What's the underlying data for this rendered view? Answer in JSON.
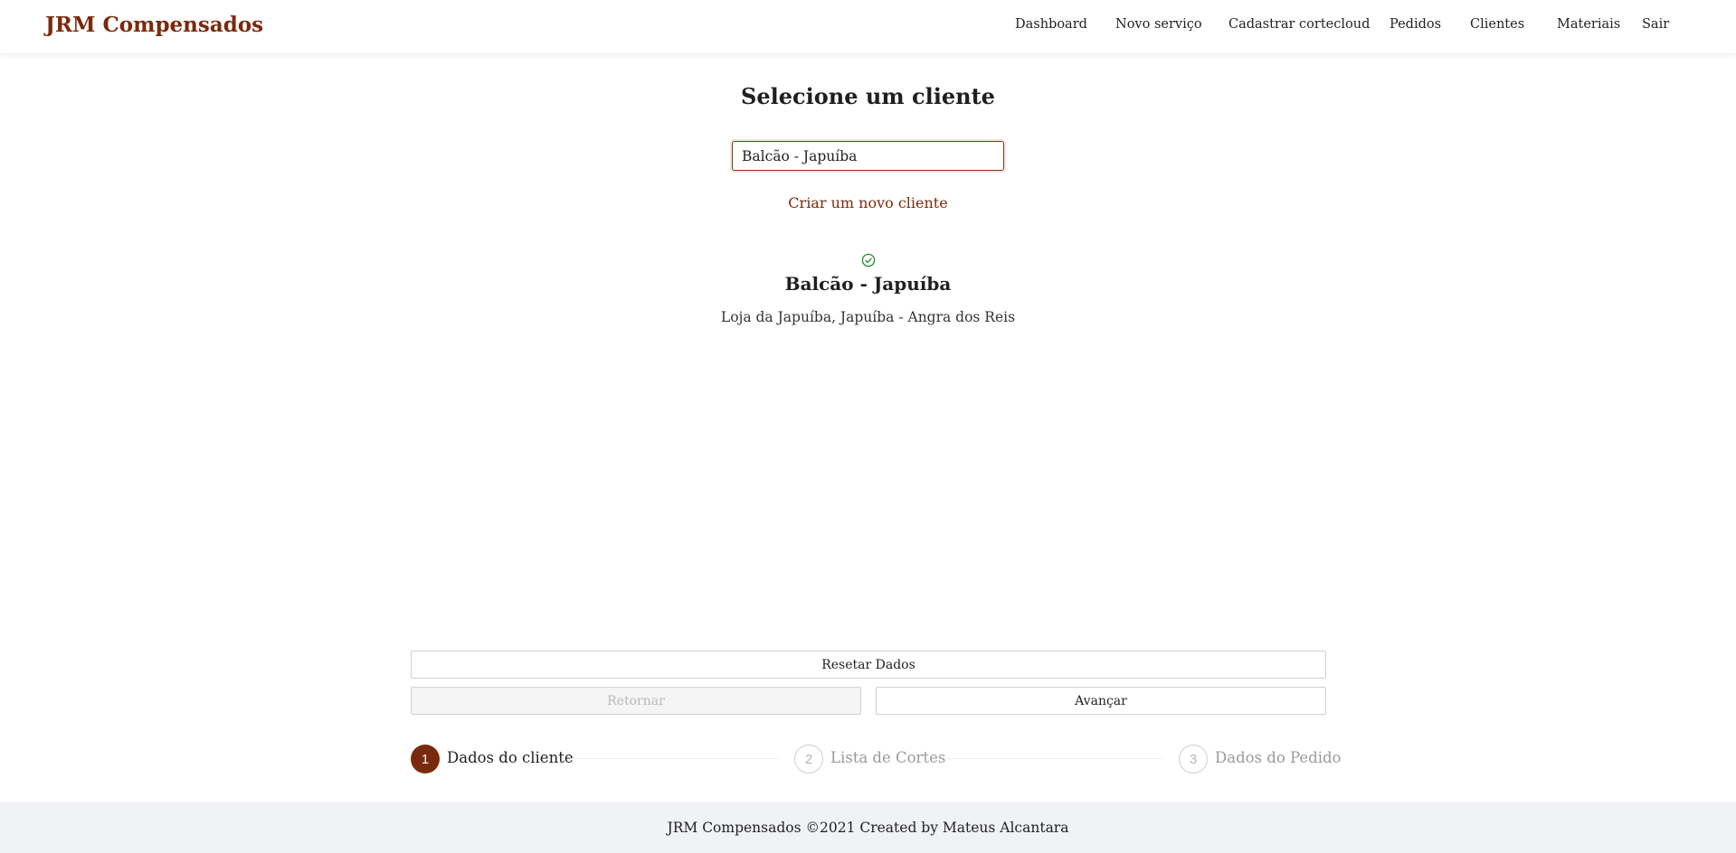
{
  "header": {
    "brand": "JRM Compensados",
    "nav": [
      {
        "label": "Dashboard"
      },
      {
        "label": "Novo serviço"
      },
      {
        "label": "Cadastrar cortecloud"
      },
      {
        "label": "Pedidos"
      },
      {
        "label": "Clientes"
      },
      {
        "label": "Materiais"
      },
      {
        "label": "Sair"
      }
    ]
  },
  "main": {
    "title": "Selecione um cliente",
    "search": {
      "value": "Balcão - Japuíba"
    },
    "new_client_link": "Criar um novo cliente",
    "selected_client": {
      "status_icon": "check-circle-icon",
      "name": "Balcão - Japuíba",
      "address": "Loja da Japuíba, Japuíba - Angra dos Reis"
    },
    "buttons": {
      "reset": "Resetar Dados",
      "back": "Retornar",
      "next": "Avançar"
    },
    "steps": [
      {
        "number": "1",
        "label": "Dados do cliente",
        "status": "active"
      },
      {
        "number": "2",
        "label": "Lista de Cortes",
        "status": "inactive"
      },
      {
        "number": "3",
        "label": "Dados do Pedido",
        "status": "inactive"
      }
    ]
  },
  "footer": {
    "text": "JRM Compensados ©2021 Created by Mateus Alcantara"
  },
  "colors": {
    "brand": "#7a2a0c",
    "success": "#1a8a2e",
    "footer_bg": "#f0f2f5"
  }
}
